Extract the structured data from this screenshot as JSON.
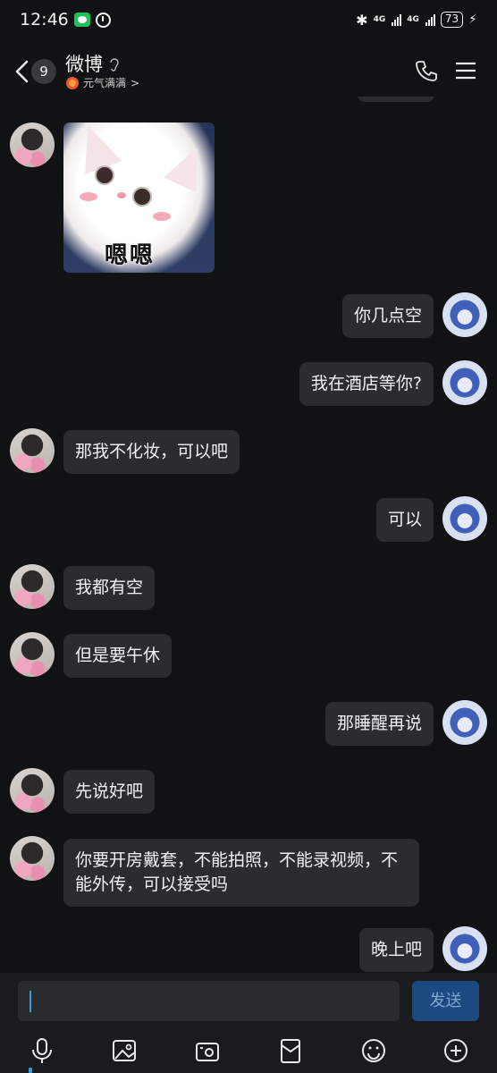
{
  "status_bar": {
    "time": "12:46",
    "network_1": "4G",
    "network_2": "4G",
    "battery": "73"
  },
  "header": {
    "unread_count": "9",
    "contact_name": "微博",
    "status_text": "元气满满",
    "status_chevron": ">"
  },
  "messages": [
    {
      "side": "left",
      "type": "sticker",
      "text": "嗯嗯"
    },
    {
      "side": "right",
      "type": "text",
      "text": "你几点空"
    },
    {
      "side": "right",
      "type": "text",
      "text": "我在酒店等你?"
    },
    {
      "side": "left",
      "type": "text",
      "text": "那我不化妆，可以吧"
    },
    {
      "side": "right",
      "type": "text",
      "text": "可以"
    },
    {
      "side": "left",
      "type": "text",
      "text": "我都有空"
    },
    {
      "side": "left",
      "type": "text",
      "text": "但是要午休"
    },
    {
      "side": "right",
      "type": "text",
      "text": "那睡醒再说"
    },
    {
      "side": "left",
      "type": "text",
      "text": "先说好吧"
    },
    {
      "side": "left",
      "type": "text",
      "text": "你要开房戴套，不能拍照，不能录视频，不能外传，可以接受吗"
    },
    {
      "side": "right",
      "type": "text",
      "text": "晚上吧"
    }
  ],
  "input": {
    "value": "",
    "send_label": "发送"
  },
  "toolbar": {
    "icons": [
      "microphone-icon",
      "image-icon",
      "camera-icon",
      "red-packet-icon",
      "emoji-icon",
      "plus-icon"
    ]
  },
  "colors": {
    "background": "#111214",
    "bubble": "#2b2c2f",
    "send_button": "#1c4a80",
    "accent": "#3a9ad9"
  }
}
